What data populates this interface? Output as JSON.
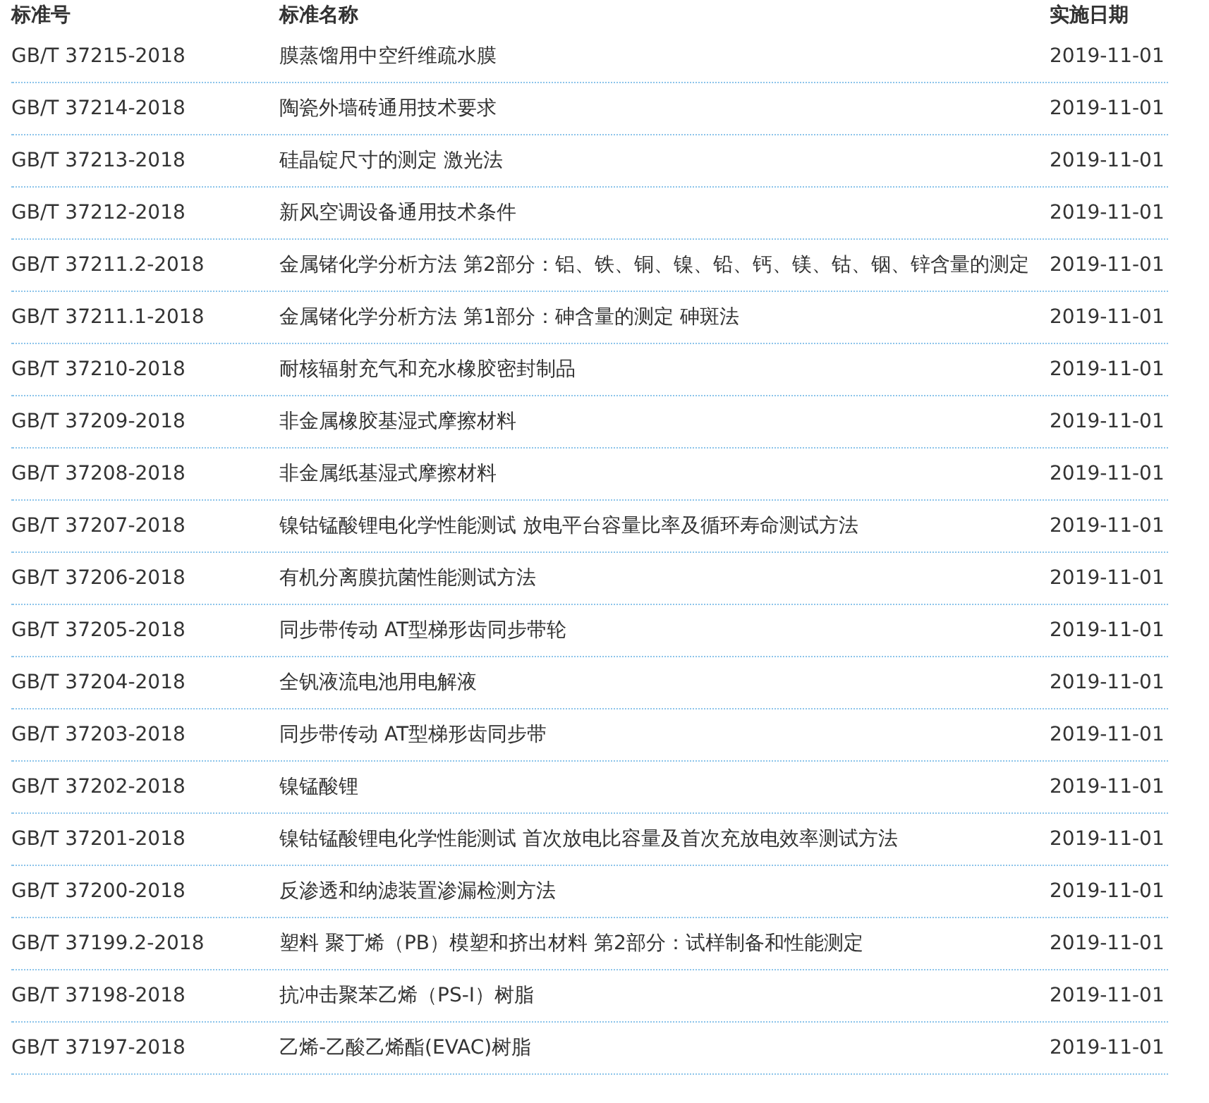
{
  "table": {
    "columns": [
      "标准号",
      "标准名称",
      "实施日期"
    ],
    "rows": [
      {
        "code": "GB/T 37215-2018",
        "name": "膜蒸馏用中空纤维疏水膜",
        "date": "2019-11-01"
      },
      {
        "code": "GB/T 37214-2018",
        "name": "陶瓷外墙砖通用技术要求",
        "date": "2019-11-01"
      },
      {
        "code": "GB/T 37213-2018",
        "name": "硅晶锭尺寸的测定 激光法",
        "date": "2019-11-01"
      },
      {
        "code": "GB/T 37212-2018",
        "name": "新风空调设备通用技术条件",
        "date": "2019-11-01"
      },
      {
        "code": "GB/T 37211.2-2018",
        "name": "金属锗化学分析方法 第2部分：铝、铁、铜、镍、铅、钙、镁、钴、铟、锌含量的测定",
        "date": "2019-11-01"
      },
      {
        "code": "GB/T 37211.1-2018",
        "name": "金属锗化学分析方法 第1部分：砷含量的测定 砷斑法",
        "date": "2019-11-01"
      },
      {
        "code": "GB/T 37210-2018",
        "name": "耐核辐射充气和充水橡胶密封制品",
        "date": "2019-11-01"
      },
      {
        "code": "GB/T 37209-2018",
        "name": "非金属橡胶基湿式摩擦材料",
        "date": "2019-11-01"
      },
      {
        "code": "GB/T 37208-2018",
        "name": "非金属纸基湿式摩擦材料",
        "date": "2019-11-01"
      },
      {
        "code": "GB/T 37207-2018",
        "name": "镍钴锰酸锂电化学性能测试 放电平台容量比率及循环寿命测试方法",
        "date": "2019-11-01"
      },
      {
        "code": "GB/T 37206-2018",
        "name": "有机分离膜抗菌性能测试方法",
        "date": "2019-11-01"
      },
      {
        "code": "GB/T 37205-2018",
        "name": "同步带传动 AT型梯形齿同步带轮",
        "date": "2019-11-01"
      },
      {
        "code": "GB/T 37204-2018",
        "name": "全钒液流电池用电解液",
        "date": "2019-11-01"
      },
      {
        "code": "GB/T 37203-2018",
        "name": "同步带传动 AT型梯形齿同步带",
        "date": "2019-11-01"
      },
      {
        "code": "GB/T 37202-2018",
        "name": "镍锰酸锂",
        "date": "2019-11-01"
      },
      {
        "code": "GB/T 37201-2018",
        "name": "镍钴锰酸锂电化学性能测试 首次放电比容量及首次充放电效率测试方法",
        "date": "2019-11-01"
      },
      {
        "code": "GB/T 37200-2018",
        "name": "反渗透和纳滤装置渗漏检测方法",
        "date": "2019-11-01"
      },
      {
        "code": "GB/T 37199.2-2018",
        "name": "塑料 聚丁烯（PB）模塑和挤出材料 第2部分：试样制备和性能测定",
        "date": "2019-11-01"
      },
      {
        "code": "GB/T 37198-2018",
        "name": "抗冲击聚苯乙烯（PS-I）树脂",
        "date": "2019-11-01"
      },
      {
        "code": "GB/T 37197-2018",
        "name": "乙烯-乙酸乙烯酯(EVAC)树脂",
        "date": "2019-11-01"
      }
    ]
  }
}
